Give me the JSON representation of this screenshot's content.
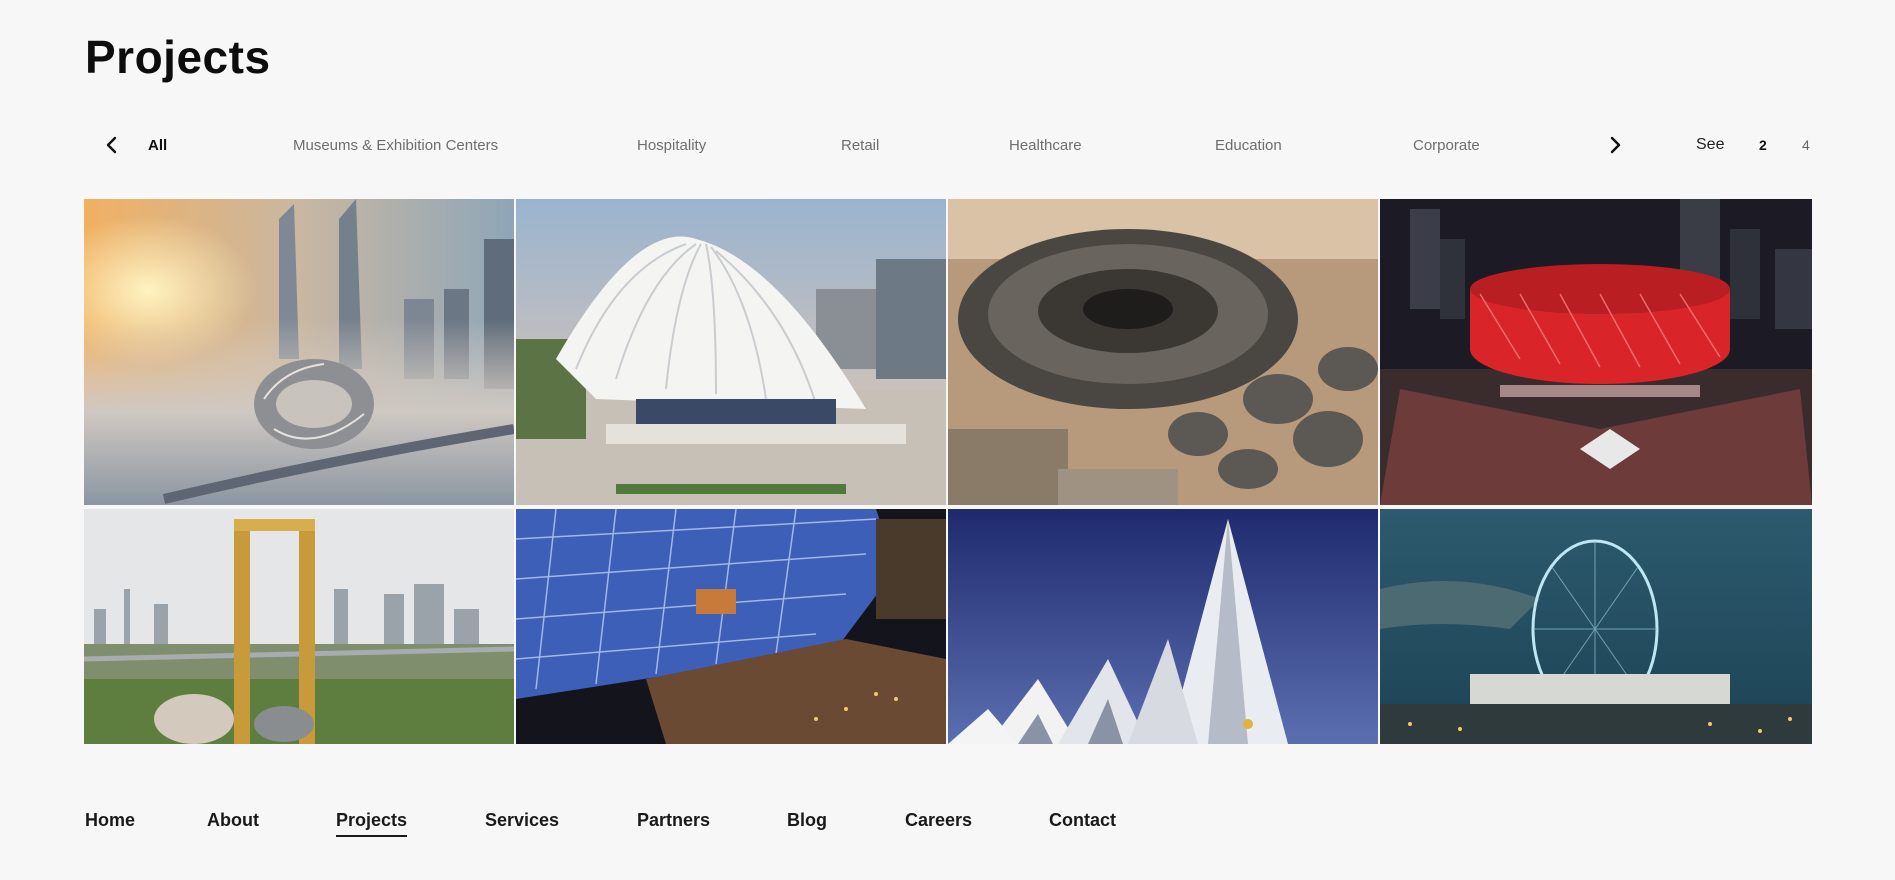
{
  "page": {
    "title": "Projects"
  },
  "filters": {
    "categories": [
      {
        "label": "All",
        "active": true
      },
      {
        "label": "Museums & Exhibition Centers",
        "active": false
      },
      {
        "label": "Hospitality",
        "active": false
      },
      {
        "label": "Retail",
        "active": false
      },
      {
        "label": "Healthcare",
        "active": false
      },
      {
        "label": "Education",
        "active": false
      },
      {
        "label": "Corporate",
        "active": false
      }
    ],
    "see_label": "See",
    "page_options": [
      "2",
      "4"
    ],
    "current_page_option": "2"
  },
  "gallery": {
    "icons": [
      "museum-of-the-future-image",
      "uae-pavilion-image",
      "sustainability-pavilion-image",
      "coca-cola-arena-image",
      "dubai-frame-image",
      "lit-roof-structure-image",
      "angular-white-building-image",
      "ain-dubai-wheel-image"
    ]
  },
  "footer_nav": {
    "items": [
      "Home",
      "About",
      "Projects",
      "Services",
      "Partners",
      "Blog",
      "Careers",
      "Contact"
    ],
    "active": "Projects"
  }
}
